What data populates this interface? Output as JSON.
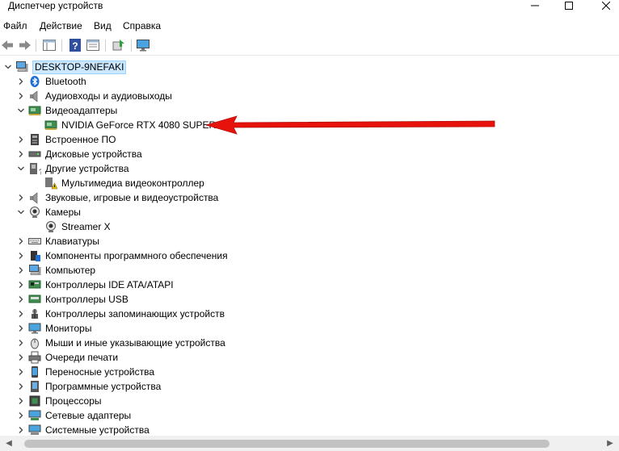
{
  "window": {
    "title": "Диспетчер устройств"
  },
  "menu": [
    "Файл",
    "Действие",
    "Вид",
    "Справка"
  ],
  "tree": {
    "root": "DESKTOP-9NEFAKI",
    "items": [
      {
        "label": "Bluetooth",
        "icon": "bluetooth-icon",
        "state": "collapsed"
      },
      {
        "label": "Аудиовходы и аудиовыходы",
        "icon": "speaker-icon",
        "state": "collapsed"
      },
      {
        "label": "Видеоадаптеры",
        "icon": "display-adapter-icon",
        "state": "expanded",
        "children": [
          {
            "label": "NVIDIA GeForce RTX 4080 SUPER",
            "icon": "display-adapter-icon"
          }
        ]
      },
      {
        "label": "Встроенное ПО",
        "icon": "firmware-icon",
        "state": "collapsed"
      },
      {
        "label": "Дисковые устройства",
        "icon": "disk-drive-icon",
        "state": "collapsed"
      },
      {
        "label": "Другие устройства",
        "icon": "unknown-device-icon",
        "state": "expanded",
        "children": [
          {
            "label": "Мультимедиа видеоконтроллер",
            "icon": "warning-device-icon"
          }
        ]
      },
      {
        "label": "Звуковые, игровые и видеоустройства",
        "icon": "speaker-icon",
        "state": "collapsed"
      },
      {
        "label": "Камеры",
        "icon": "camera-icon",
        "state": "expanded",
        "children": [
          {
            "label": "Streamer X",
            "icon": "camera-icon"
          }
        ]
      },
      {
        "label": "Клавиатуры",
        "icon": "keyboard-icon",
        "state": "collapsed"
      },
      {
        "label": "Компоненты программного обеспечения",
        "icon": "software-component-icon",
        "state": "collapsed"
      },
      {
        "label": "Компьютер",
        "icon": "computer-icon",
        "state": "collapsed"
      },
      {
        "label": "Контроллеры IDE ATA/ATAPI",
        "icon": "ide-controller-icon",
        "state": "collapsed"
      },
      {
        "label": "Контроллеры USB",
        "icon": "usb-controller-icon",
        "state": "collapsed"
      },
      {
        "label": "Контроллеры запоминающих устройств",
        "icon": "storage-controller-icon",
        "state": "collapsed"
      },
      {
        "label": "Мониторы",
        "icon": "monitor-icon",
        "state": "collapsed"
      },
      {
        "label": "Мыши и иные указывающие устройства",
        "icon": "mouse-icon",
        "state": "collapsed"
      },
      {
        "label": "Очереди печати",
        "icon": "printer-icon",
        "state": "collapsed"
      },
      {
        "label": "Переносные устройства",
        "icon": "portable-device-icon",
        "state": "collapsed"
      },
      {
        "label": "Программные устройства",
        "icon": "software-device-icon",
        "state": "collapsed"
      },
      {
        "label": "Процессоры",
        "icon": "processor-icon",
        "state": "collapsed"
      },
      {
        "label": "Сетевые адаптеры",
        "icon": "network-adapter-icon",
        "state": "collapsed"
      },
      {
        "label": "Системные устройства",
        "icon": "system-device-icon",
        "state": "collapsed"
      }
    ]
  },
  "colors": {
    "selection_bg": "#cce8ff",
    "selection_border": "#99d1ff",
    "arrow": "#e8120c"
  }
}
